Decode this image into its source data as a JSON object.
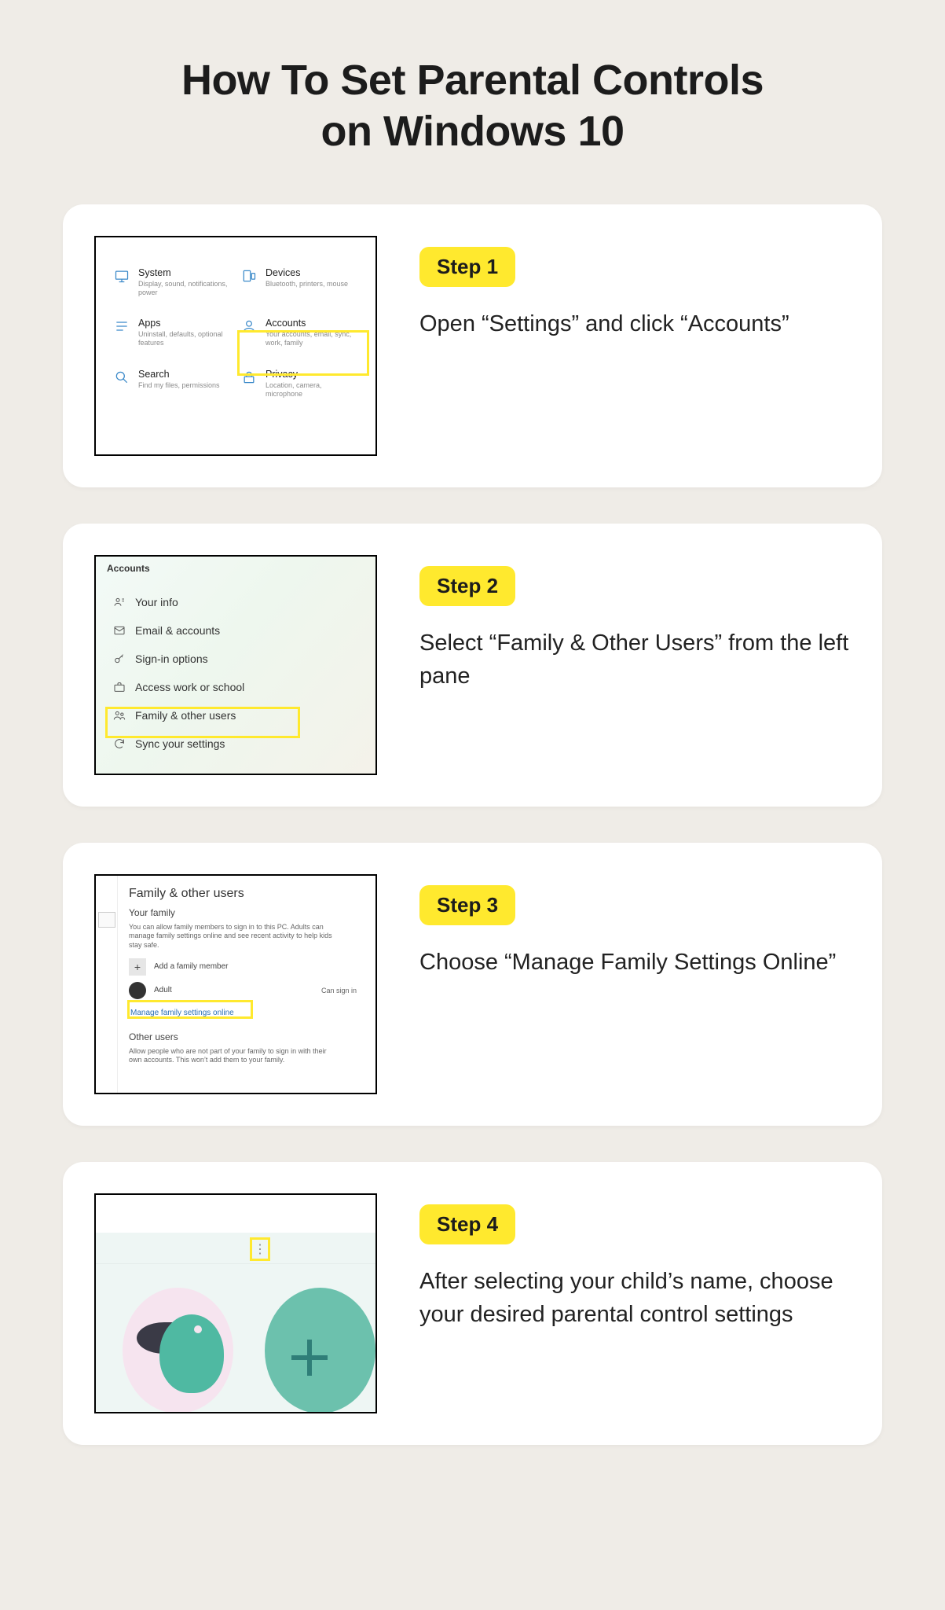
{
  "title_line1": "How To Set Parental Controls",
  "title_line2": "on Windows 10",
  "steps": [
    {
      "badge": "Step 1",
      "text": "Open “Settings” and click “Accounts”"
    },
    {
      "badge": "Step 2",
      "text": "Select “Family & Other Users” from the left pane"
    },
    {
      "badge": "Step 3",
      "text": "Choose “Manage Family Settings Online”"
    },
    {
      "badge": "Step 4",
      "text": "After selecting your child’s name, choose your desired parental control settings"
    }
  ],
  "settings_tiles": {
    "system": {
      "title": "System",
      "desc": "Display, sound, notifications, power"
    },
    "devices": {
      "title": "Devices",
      "desc": "Bluetooth, printers, mouse"
    },
    "apps": {
      "title": "Apps",
      "desc": "Uninstall, defaults, optional features"
    },
    "accounts": {
      "title": "Accounts",
      "desc": "Your accounts, email, sync, work, family"
    },
    "search": {
      "title": "Search",
      "desc": "Find my files, permissions"
    },
    "privacy": {
      "title": "Privacy",
      "desc": "Location, camera, microphone"
    }
  },
  "accounts_sidebar": {
    "header": "Accounts",
    "items": [
      "Your info",
      "Email & accounts",
      "Sign-in options",
      "Access work or school",
      "Family & other users",
      "Sync your settings"
    ]
  },
  "family_page": {
    "heading": "Family & other users",
    "your_family": "Your family",
    "family_blurb": "You can allow family members to sign in to this PC. Adults can manage family settings online and see recent activity to help kids stay safe.",
    "add_member": "Add a family member",
    "adult_label": "Adult",
    "can_sign_in": "Can sign in",
    "manage_link": "Manage family settings online",
    "other_users": "Other users",
    "other_blurb": "Allow people who are not part of your family to sign in with their own accounts. This won’t add them to your family."
  },
  "more_menu_glyph": "⋮"
}
